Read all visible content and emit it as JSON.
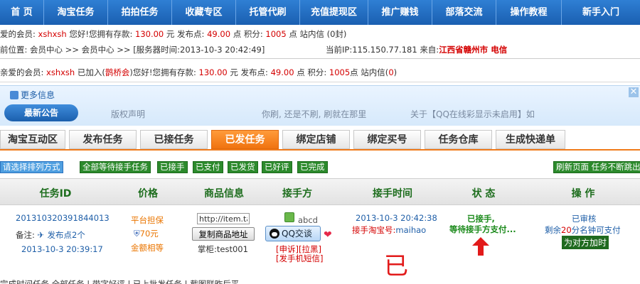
{
  "nav": [
    "首 页",
    "淘宝任务",
    "拍拍任务",
    "收藏专区",
    "托管代刷",
    "充值提现区",
    "推广赚钱",
    "部落交流",
    "操作教程",
    "新手入门"
  ],
  "account": {
    "prefix": "爱的会员:",
    "username": "xshxsh",
    "greeting": "您好!您拥有存款:",
    "deposit": "130.00",
    "deposit_unit": "元 发布点:",
    "points": "49.00",
    "points_unit": "点  积分:",
    "score": "1005",
    "score_unit": "点 站内信",
    "messages": "(0封)"
  },
  "location": {
    "path": "前位置: 会员中心 >> 会员中心 >> [服务器时间:2013-10-3 20:42:49]",
    "ip_label": "当前IP:",
    "ip": "115.150.77.181",
    "from_label": "来自:",
    "from": "江西省赣州市 电信"
  },
  "welcome": {
    "prefix": "亲爱的会员:",
    "username": "xshxsh",
    "joined_pre": "已加入(",
    "group": "鹊桥会",
    "joined_post": ")您好!您拥有存款:",
    "deposit": "130.00",
    "deposit_unit": "元  发布点:",
    "points": "49.00",
    "points_unit": "点  积分:",
    "score": "1005",
    "score_unit": "点 站内信(",
    "messages": "0",
    "close_paren": ")"
  },
  "news": {
    "more": "更多信息",
    "announce": "最新公告",
    "items": [
      "版权声明",
      "你刷, 还是不刷, 刷就在那里",
      "关于【QQ在线彩显示未启用】如"
    ],
    "close": "✕"
  },
  "tabs": {
    "items": [
      "淘宝互动区",
      "发布任务",
      "已接任务",
      "已发任务",
      "绑定店铺",
      "绑定买号",
      "任务仓库",
      "生成快递单"
    ],
    "active_index": 3
  },
  "filters": {
    "sort": "请选择排列方式",
    "items": [
      "全部等待接手任务",
      "已接手",
      "已支付",
      "已发货",
      "已好评",
      "已完成"
    ],
    "refresh": "刷新页面 任务不断跳出"
  },
  "table": {
    "headers": [
      "任务ID",
      "价格",
      "商品信息",
      "接手方",
      "接手时间",
      "状 态",
      "操 作"
    ],
    "row": {
      "task_id": "201310320391844013",
      "note_label": "备注:",
      "publish_points": "发布点2个",
      "created": "2013-10-3 20:39:17",
      "price_guarantee": "平台担保",
      "price": "70元",
      "price_equal": "金额相等",
      "url_value": "http://item.taob",
      "copy_label": "复制商品地址",
      "shop_label": "掌柜:",
      "shop": "test001",
      "receiver": "abcd",
      "qq_label": "QQ交谈",
      "complain_links": "[申诉][拉黑]",
      "sms_link": "[发手机短信]",
      "accept_time": "2013-10-3 20:42:38",
      "buyer_label": "接手淘宝号:",
      "buyer": "maihao",
      "status_line1": "已接手,",
      "status_line2": "等待接手方支付...",
      "op_line1": "已审核",
      "op_line2_pre": "剩余",
      "op_minutes": "20",
      "op_line2_post": "分名钟可支付",
      "op_button": "为对方加时"
    }
  },
  "annotation": "已",
  "footer": "完成时间任务 全部任务 | 带字好评 | 已上批发任务 | 截图联昨后平"
}
